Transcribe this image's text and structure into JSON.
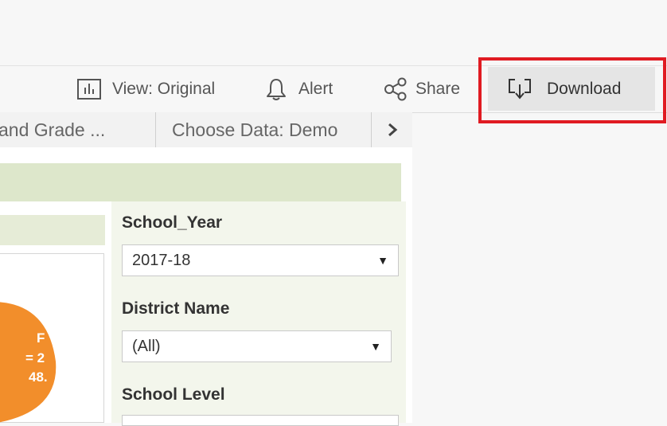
{
  "toolbar": {
    "view_label": "View: Original",
    "alert_label": "Alert",
    "share_label": "Share",
    "download_label": "Download"
  },
  "tabs": [
    "and Grade ...",
    "Choose Data: Demo"
  ],
  "chart": {
    "slice_label_lines": [
      "F",
      "= 2",
      "48."
    ],
    "slice_color": "#f28e2b"
  },
  "filters": {
    "school_year": {
      "title": "School_Year",
      "value": "2017-18"
    },
    "district_name": {
      "title": "District Name",
      "value": "(All)"
    },
    "school_level": {
      "title": "School Level"
    }
  },
  "highlight_color": "#e01b22"
}
